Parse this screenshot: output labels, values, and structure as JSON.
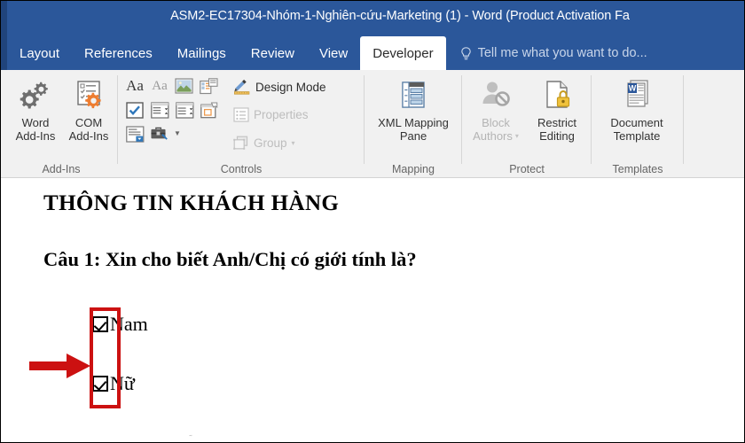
{
  "window": {
    "title": "ASM2-EC17304-Nhóm-1-Nghiên-cứu-Marketing (1) - Word (Product Activation Fa",
    "titlebar_color": "#2b579a"
  },
  "tabs": [
    {
      "label": "Layout",
      "active": false
    },
    {
      "label": "References",
      "active": false
    },
    {
      "label": "Mailings",
      "active": false
    },
    {
      "label": "Review",
      "active": false
    },
    {
      "label": "View",
      "active": false
    },
    {
      "label": "Developer",
      "active": true
    }
  ],
  "tell_me": {
    "icon": "lightbulb-icon",
    "placeholder": "Tell me what you want to do..."
  },
  "ribbon": {
    "groups": [
      {
        "name": "Add-Ins",
        "label": "Add-Ins",
        "buttons": [
          {
            "icon": "gears-icon",
            "line1": "Word",
            "line2": "Add-Ins",
            "disabled": false
          },
          {
            "icon": "com-addins-icon",
            "line1": "COM",
            "line2": "Add-Ins",
            "disabled": false
          }
        ]
      },
      {
        "name": "Controls",
        "label": "Controls",
        "control_icons": [
          {
            "name": "rich-text-content-control-icon",
            "glyph": "Aa"
          },
          {
            "name": "plain-text-content-control-icon",
            "glyph": "Aa"
          },
          {
            "name": "picture-content-control-icon",
            "glyph": ""
          },
          {
            "name": "building-block-gallery-content-control-icon",
            "glyph": ""
          },
          {
            "name": "check-box-content-control-icon",
            "glyph": ""
          },
          {
            "name": "combo-box-content-control-icon",
            "glyph": ""
          },
          {
            "name": "drop-down-list-content-control-icon",
            "glyph": ""
          },
          {
            "name": "date-picker-content-control-icon",
            "glyph": ""
          },
          {
            "name": "repeating-section-content-control-icon",
            "glyph": ""
          },
          {
            "name": "legacy-tools-icon",
            "glyph": ""
          }
        ],
        "commands": [
          {
            "name": "design-mode",
            "label": "Design Mode",
            "icon": "design-mode-icon",
            "disabled": false
          },
          {
            "name": "properties",
            "label": "Properties",
            "icon": "properties-icon",
            "disabled": true
          },
          {
            "name": "group",
            "label": "Group",
            "icon": "group-icon",
            "disabled": true,
            "caret": true
          }
        ]
      },
      {
        "name": "Mapping",
        "label": "Mapping",
        "buttons": [
          {
            "icon": "xml-mapping-pane-icon",
            "line1": "XML Mapping",
            "line2": "Pane",
            "disabled": false
          }
        ]
      },
      {
        "name": "Protect",
        "label": "Protect",
        "buttons": [
          {
            "icon": "block-authors-icon",
            "line1": "Block",
            "line2": "Authors",
            "disabled": true,
            "caret": true
          },
          {
            "icon": "restrict-editing-icon",
            "line1": "Restrict",
            "line2": "Editing",
            "disabled": false
          }
        ]
      },
      {
        "name": "Templates",
        "label": "Templates",
        "buttons": [
          {
            "icon": "document-template-icon",
            "line1": "Document",
            "line2": "Template",
            "disabled": false
          }
        ]
      }
    ]
  },
  "document": {
    "heading": "THÔNG TIN KHÁCH HÀNG",
    "question": "Câu 1: Xin cho biết Anh/Chị có giới tính là?",
    "options": [
      {
        "label": "Nam",
        "checked": true
      },
      {
        "label": "Nữ",
        "checked": true
      }
    ]
  },
  "annotation": {
    "highlight_color": "#cc1111",
    "arrow": "right-arrow-annotation",
    "box": "checkbox-group-highlight"
  }
}
